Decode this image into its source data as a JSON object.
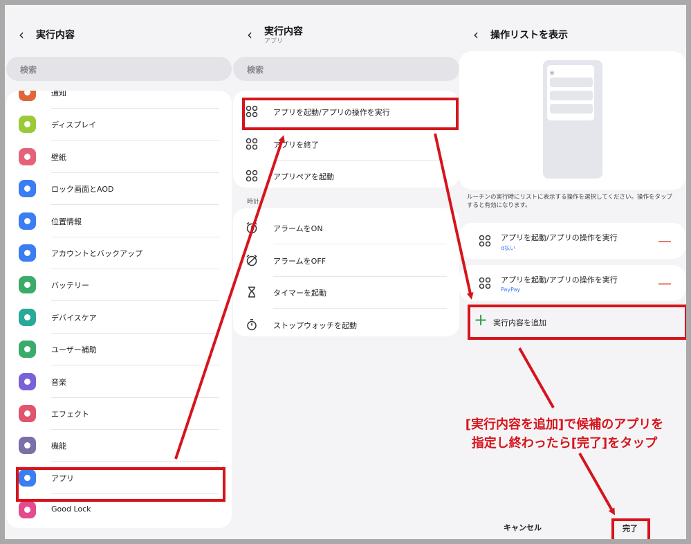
{
  "left": {
    "title": "実行内容",
    "search_placeholder": "検索",
    "items": [
      {
        "label": "通知",
        "color": "#e0663a"
      },
      {
        "label": "ディスプレイ",
        "color": "#9acb36"
      },
      {
        "label": "壁紙",
        "color": "#e5637a"
      },
      {
        "label": "ロック画面とAOD",
        "color": "#3b7df2"
      },
      {
        "label": "位置情報",
        "color": "#3b7df2"
      },
      {
        "label": "アカウントとバックアップ",
        "color": "#3b7df2"
      },
      {
        "label": "バッテリー",
        "color": "#3bab6a"
      },
      {
        "label": "デバイスケア",
        "color": "#2aa89a"
      },
      {
        "label": "ユーザー補助",
        "color": "#3bab6a"
      },
      {
        "label": "音楽",
        "color": "#7b61d9"
      },
      {
        "label": "エフェクト",
        "color": "#e0546e"
      },
      {
        "label": "機能",
        "color": "#7b6fa8"
      },
      {
        "label": "アプリ",
        "color": "#3b7df2"
      },
      {
        "label": "Good Lock",
        "color": "#e34b8c"
      }
    ]
  },
  "middle": {
    "title": "実行内容",
    "subtitle": "アプリ",
    "search_placeholder": "検索",
    "app_items": [
      "アプリを起動/アプリの操作を実行",
      "アプリを終了",
      "アプリペアを起動"
    ],
    "section_label": "時計",
    "clock_items": [
      "アラームをON",
      "アラームをOFF",
      "タイマーを起動",
      "ストップウォッチを起動"
    ]
  },
  "right": {
    "title": "操作リストを表示",
    "description": "ルーチンの実行時にリストに表示する操作を選択してください。操作をタップすると有効になります。",
    "actions": [
      {
        "label": "アプリを起動/アプリの操作を実行",
        "sub": "d払い"
      },
      {
        "label": "アプリを起動/アプリの操作を実行",
        "sub": "PayPay"
      }
    ],
    "add_label": "実行内容を追加",
    "cancel_label": "キャンセル",
    "done_label": "完了"
  },
  "annotation": {
    "line1": "[実行内容を追加]で候補のアプリを",
    "line2": "指定し終わったら[完了]をタップ"
  },
  "colors": {
    "accent_red": "#d6141c",
    "remove": "#e0412f",
    "add_plus": "#2e9e4e",
    "sub_text": "#3b7df2"
  }
}
